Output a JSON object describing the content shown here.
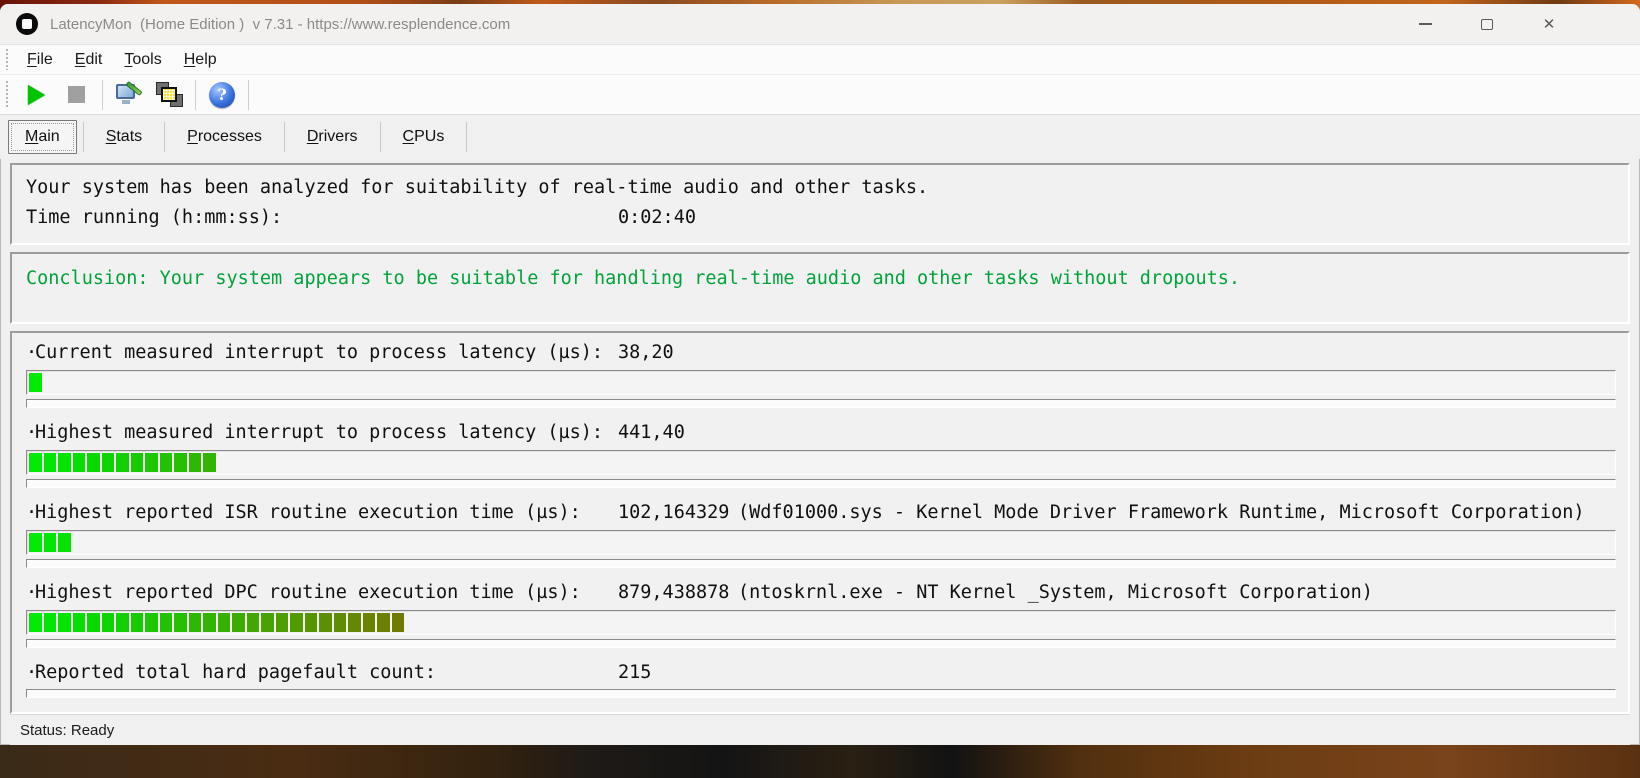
{
  "window": {
    "title": "LatencyMon  (Home Edition )  v 7.31 - https://www.resplendence.com",
    "close_glyph": "✕"
  },
  "menu": {
    "items": [
      {
        "label": "File",
        "underline": 0
      },
      {
        "label": "Edit",
        "underline": 0
      },
      {
        "label": "Tools",
        "underline": 0
      },
      {
        "label": "Help",
        "underline": 0
      }
    ]
  },
  "toolbar": {
    "help_glyph": "?"
  },
  "tabs": [
    {
      "label": "Main",
      "underline": 0,
      "selected": true
    },
    {
      "label": "Stats",
      "underline": 0,
      "selected": false
    },
    {
      "label": "Processes",
      "underline": 0,
      "selected": false
    },
    {
      "label": "Drivers",
      "underline": 0,
      "selected": false
    },
    {
      "label": "CPUs",
      "underline": 0,
      "selected": false
    }
  ],
  "analysis": {
    "line1": "Your system has been analyzed for suitability of real-time audio and other tasks.",
    "time_label": "Time running (h:mm:ss):",
    "time_value": "0:02:40"
  },
  "conclusion": {
    "text": "Conclusion: Your system appears to be suitable for handling real-time audio and other tasks without dropouts.",
    "color": "#00a33a"
  },
  "metrics_bullet": "·",
  "metrics": [
    {
      "label": "Current measured interrupt to process latency (µs):",
      "value": "38,20",
      "detail": "",
      "segments": 1
    },
    {
      "label": "Highest measured interrupt to process latency (µs):",
      "value": "441,40",
      "detail": "",
      "segments": 13
    },
    {
      "label": "Highest reported ISR routine execution time (µs):",
      "value": "102,164329",
      "detail": "(Wdf01000.sys - Kernel Mode Driver Framework Runtime, Microsoft Corporation)",
      "segments": 3
    },
    {
      "label": "Highest reported DPC routine execution time (µs):",
      "value": "879,438878",
      "detail": "(ntoskrnl.exe - NT Kernel _System, Microsoft Corporation)",
      "segments": 26
    },
    {
      "label": "Reported total hard pagefault count:",
      "value": "215",
      "detail": "",
      "segments": null
    }
  ],
  "bar_colors": {
    "start": "#00e600",
    "end": "#747a00"
  },
  "status_bar": {
    "text": "Status: Ready"
  }
}
